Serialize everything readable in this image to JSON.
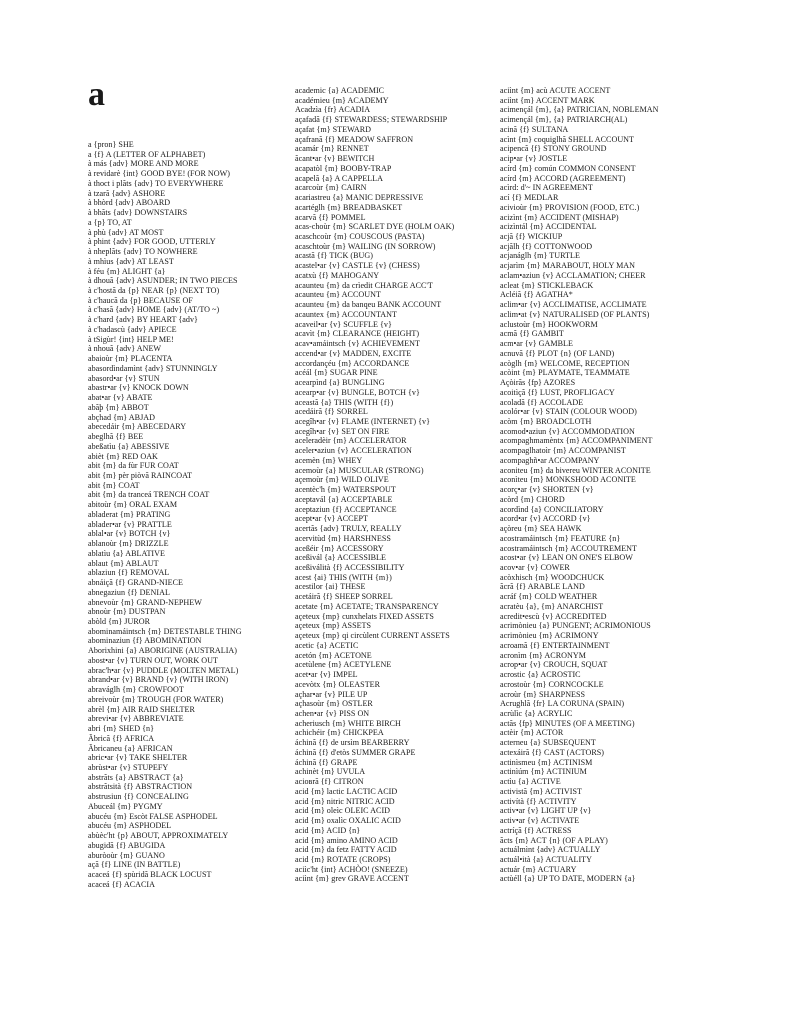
{
  "page": {
    "headword": "a",
    "background_color": "#ffffff",
    "text_color": "#1a1a1a"
  },
  "columns": [
    {
      "id": "column-1",
      "entries": [
        "a {pron} SHE",
        "a {f} A (LETTER OF ALPHABET)",
        "à más {adv} MORE AND MORE",
        "à revidarè {int} GOOD BYE! (FOR NOW)",
        "à thoct i plãts {adv} TO EVERYWHERE",
        "à tzarã {adv} ASHORE",
        "à bhòrd {adv} ABOARD",
        "à bhãts {adv} DOWNSTAIRS",
        "a {p} TO, AT",
        "à phù {adv} AT MOST",
        "à phint {adv} FOR GOOD, UTTERLY",
        "à nheplãts {adv} TO NOWHERE",
        "à mhìus {adv} AT LEAST",
        "à féu {m} ALIGHT {a}",
        "à dhouã {adv} ASUNDER; IN TWO PIECES",
        "à c'hostã da {p} NEAR {p} (NEXT TO)",
        "à c'haucã da {p} BECAUSE OF",
        "à c'hasã {adv} HOME {adv} (AT/TO ~)",
        "à c'hard {adv} BY HEART {adv}",
        "à c'hadascù {adv} APIECE",
        "à tSigùr! {int} HELP ME!",
        "à nhouã {adv} ANEW",
        "abaioùr {m} PLACENTA",
        "abasordìndamìnt {adv} STUNNINGLY",
        "abasord•ar {v} STUN",
        "abastr•ar {v} KNOCK DOWN",
        "abat•ar {v} ABATE",
        "abãþ {m} ABBOT",
        "abçhad {m} ABJAD",
        "abecedáir {m} ABECEDARY",
        "abeglhã {f} BEE",
        "abeßatìu {a} ABESSIVE",
        "abièt {m} RED OAK",
        "abit {m} da fùr FUR COAT",
        "abit {m} pèr piòvã RAINCOAT",
        "abit {m} COAT",
        "abit {m} da tranceá TRENCH COAT",
        "abitoùr {m} ORAL EXAM",
        "abladerat {m} PRATING",
        "ablader•ar {v} PRATTLE",
        "ablal•ar {v} BOTCH {v}",
        "ablanoùr {m} DRIZZLE",
        "ablatìu {a} ABLATIVE",
        "ablaut {m} ABLAUT",
        "ablaziun {f} REMOVAL",
        "abnáiçã {f} GRAND-NIECE",
        "abnegaziun {f} DENIAL",
        "abnevoùr {m} GRAND-NEPHEW",
        "abnoùr {m} DUSTPAN",
        "abòld {m} JUROR",
        "abominamáintsch {m} DETESTABLE THING",
        "abominaziun {f} ABOMINATION",
        "Aborixhini {a} ABORIGINE (AUSTRALIA)",
        "abost•ar {v} TURN OUT, WORK OUT",
        "abrac'h•ar {v} PUDDLE (MOLTEN METAL)",
        "abrand•ar {v} BRAND {v} (WITH IRON)",
        "abraváglh {m} CROWFOOT",
        "abreivoùr {m} TROUGH (FOR WATER)",
        "abrèl {m} AIR RAID SHELTER",
        "abrevi•ar {v} ABBREVIATE",
        "abri {m} SHED {n}",
        "Ãbricã {f} AFRICA",
        "Ãbricaneu {a} AFRICAN",
        "abric•ar {v} TAKE SHELTER",
        "abrùst•ar {v} STUPEFY",
        "abstrãts {a} ABSTRACT {a}",
        "abstrãtsità {f} ABSTRACTION",
        "abstrusiun {f} CONCEALING",
        "Abuceál {m} PYGMY",
        "abucéu {m} Escòt FALSE ASPHODEL",
        "abucéu {m} ASPHODEL",
        "abùèc'ht {p} ABOUT, APPROXIMATELY",
        "abugidã {f} ABUGIDA",
        "aburòoùr {m} GUANO",
        "açã {f} LINE (IN BATTLE)",
        "acaceá {f} spùridã BLACK LOCUST",
        "acaceá {f} ACACIA"
      ]
    },
    {
      "id": "column-2",
      "entries": [
        "academic {a} ACADEMIC",
        "académieu {m} ACADEMY",
        "Acadzìa {fr} ACADIA",
        "açafadã {f} STEWARDESS; STEWARDSHIP",
        "açafat {m} STEWARD",
        "açafranã {f} MEADOW SAFFRON",
        "acamár {m} RENNET",
        "ãcant•ar {v} BEWITCH",
        "acapatòl {m} BOOBY-TRAP",
        "acapelã {a} A CAPPELLA",
        "acarcoùr {m} CAIRN",
        "acariastreu {a} MANIC DEPRESSIVE",
        "acartéglh {m} BREADBASKET",
        "acarvã {f} POMMEL",
        "acas-choùr {m} SCARLET DYE (HOLM OAK)",
        "acaschcoùr {m} COUSCOUS (PASTA)",
        "acaschtoùr {m} WAILING (IN SORROW)",
        "acastã {f} TICK (BUG)",
        "acastel•ar {v} CASTLE {v} (CHESS)",
        "acatxù {f} MAHOGANY",
        "acaunteu {m} da crìedit CHARGE ACC'T",
        "acaunteu {m} ACCOUNT",
        "acaunteu {m} da banqeu BANK ACCOUNT",
        "acauntex {m} ACCOUNTANT",
        "acaveil•ar {v} SCUFFLE {v}",
        "acavìt {m} CLEARANCE (HEIGHT)",
        "acav•amáintsch {v} ACHIEVEMENT",
        "accend•ar {v} MADDEN, EXCITE",
        "accordançéu {m} ACCORDANCE",
        "acéál {m} SUGAR PINE",
        "acearpìnd {a} BUNGLING",
        "acearp•ar {v} BUNGLE, BOTCH {v}",
        "aceastã {a} THIS (WITH {f})",
        "acedáirã {f} SORREL",
        "acegîh•ar {v} FLAME (INTERNET) {v}",
        "acegîh•ar {v} SET ON FIRE",
        "aceleradèir {m} ACCELERATOR",
        "aceler•aziun {v} ACCELERATION",
        "acemèn {m} WHEY",
        "acemoùr {a} MUSCULAR (STRONG)",
        "açemoùr {m} WILD OLIVE",
        "acentèc'h {m} WATERSPOUT",
        "aceptavál {a} ACCEPTABLE",
        "aceptaziun {f} ACCEPTANCE",
        "acept•ar {v} ACCEPT",
        "acertãs {adv} TRULY, REALLY",
        "acervitùd {m} HARSHNESS",
        "aceßéir {m} ACCESSORY",
        "aceßivál {a} ACCESSIBLE",
        "aceßiválità {f} ACCESSIBILITY",
        "acest {ai} THIS (WITH {m})",
        "acestilor {ai} THESE",
        "acetáirã {f} SHEEP SORREL",
        "acetate {m} ACETATE; TRANSPARENCY",
        "açeteux {mp} cunxhelats FIXED ASSETS",
        "açeteux {mp} ASSETS",
        "açeteux {mp} qi circùlent CURRENT ASSETS",
        "acetic {a} ACETIC",
        "acetón {m} ACETONE",
        "acetùlene {m} ACETYLENE",
        "acet•ar {v} IMPEL",
        "acevòtx {m} OLEASTER",
        "açhar•ar {v} PILE UP",
        "açhasoùr {m} OSTLER",
        "achen•ar {v} PISS ON",
        "acheriusch {m} WHITE BIRCH",
        "achichéir {m} CHICKPEA",
        "áchinã {f} de ursìm BEARBERRY",
        "áchinã {f} d'etòs SUMMER GRAPE",
        "áchinã {f} GRAPE",
        "achinèt {m} UVULA",
        "aciовrã {f} CITRON",
        "acid {m} lactic LACTIC ACID",
        "acid {m} nitric NITRIC ACID",
        "acid {m} oleìc OLEIC ACID",
        "acid {m} oxalìc OXALIC ACID",
        "acid {m} ACID {n}",
        "acid {m} amino AMINO ACID",
        "acid {m} da fetz FATTY ACID",
        "acid {m} ROTATE (CROPS)",
        "aciìc'ht {int} ACHÒO! (SNEEZE)",
        "aciìnt {m} grev GRAVE ACCENT"
      ]
    },
    {
      "id": "column-3",
      "entries": [
        "aciìnt {m} acù ACUTE ACCENT",
        "aciìnt {m} ACCENT MARK",
        "acimençál {m}, {a} PATRICIAN, NOBLEMAN",
        "acimençál {m}, {a} PATRIARCH(AL)",
        "acinã {f} SULTANA",
        "acìnt {m} coquiglhã SHELL ACCOUNT",
        "acipencã {f} STONY GROUND",
        "acip•ar {v} JOSTLE",
        "acírd {m} común COMMON CONSENT",
        "acírd {m} ACCORD (AGREEMENT)",
        "acìrd: d'~ IN AGREEMENT",
        "ací {f} MEDLAR",
        "acivioùr {m} PROVISION (FOOD, ETC.)",
        "acizìnt {m} ACCIDENT (MISHAP)",
        "acizìntál {m} ACCIDENTAL",
        "acjã {f} WICKIUP",
        "acjãlh {f} COTTONWOOD",
        "acjanáglh {m} TURTLE",
        "acjarìm {m} MARABOUT, HOLY MAN",
        "aclam•aziun {v} ACCLAMATION; CHEER",
        "acleat {m} STICKLEBACK",
        "Acléiã {f} AGATHA*",
        "aclim•ar {v} ACCLIMATISE, ACCLIMATE",
        "aclim•at {v} NATURALISED (OF PLANTS)",
        "aclustoùr {m} HOOKWORM",
        "acmã {f} GAMBIT",
        "acm•ar {v} GAMBLE",
        "acnuvã {f} PLOT {n} (OF LAND)",
        "acòglh {m} WELCOME, RECEPTION",
        "acòint {m} PLAYMATE, TEAMMATE",
        "Açòirãs {fp} AZORES",
        "acoitìçã {f} LUST, PROFLIGACY",
        "acoladã {f} ACCOLADE",
        "acolór•ar {v} STAIN (COLOUR WOOD)",
        "acòm {m} BROADCLOTH",
        "acomod•aziun {v} ACCOMMODATION",
        "acompaghmamèntx {m} ACCOMPANIMENT",
        "acompaglhatoìr {m} ACCOMPANIST",
        "acompaghñ•ar ACCOMPANY",
        "aconiteu {m} da bivereu WINTER ACONITE",
        "aconìteu {m} MONKSHOOD ACONITE",
        "acorç•ar {v} SHORTEN {v}",
        "acòrd {m} CHORD",
        "acordìnd {a} CONCILIATORY",
        "acord•ar {v} ACCORD {v}",
        "açòreu {m} SEA HAWK",
        "acostramáintsch {m} FEATURE {n}",
        "acostramáintsch {m} ACCOUTREMENT",
        "acost•ar {v} LEAN ON ONE'S ELBOW",
        "acov•ar {v} COWER",
        "acòxhisch {m} WOODCHUCK",
        "ãcrã {f} ARABLE LAND",
        "acráf {m} COLD WEATHER",
        "acratèu {a}, {m} ANARCHIST",
        "acredit•escù {v} ACCREDITED",
        "acrimònieu {a} PUNGENT; ACRIMONIOUS",
        "acrimònieu {m} ACRIMONY",
        "acroamã {f} ENTERTAINMENT",
        "acronìm {m} ACRONYM",
        "acrop•ar {v} CROUCH, SQUAT",
        "acrostic {a} ACROSTIC",
        "acrostoùr {m} CORNCOCKLE",
        "acroùr {m} SHARPNESS",
        "Acrughlã {fr} LA CORUNA (SPAIN)",
        "acrùlìc {a} ACRYLIC",
        "actãs {fp} MINUTES (OF A MEETING)",
        "actèir {m} ACTOR",
        "acterneu {a} SUBSEQUENT",
        "actexáirã {f} CAST (ACTORS)",
        "actinìsmeu {m} ACTINISM",
        "actinìúm {m} ACTINIUM",
        "actìu {a} ACTIVE",
        "activistã {m} ACTIVIST",
        "activítà {f} ACTIVITY",
        "activ•ar {v} LIGHT UP {v}",
        "activ•ar {v} ACTIVATE",
        "actríçã {f} ACTRESS",
        "ãcts {m} ACT {n} (OF A PLAY)",
        "actuálmìnt {adv} ACTUALLY",
        "actuál•ità {a} ACTUALITY",
        "actuár {m} ACTUARY",
        "actùéll {a} UP TO DATE, MODERN {a}"
      ]
    }
  ]
}
